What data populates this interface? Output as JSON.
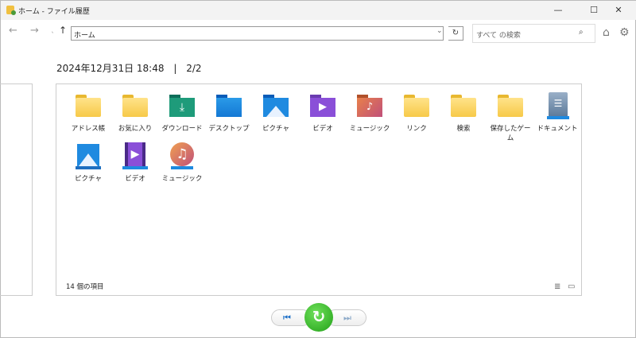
{
  "window": {
    "title": "ホーム - ファイル履歴",
    "minimize": "—",
    "maximize": "☐",
    "close": "✕"
  },
  "toolbar": {
    "back": "←",
    "forward": "→",
    "recent": "ˎ",
    "up": "↑",
    "address": "ホーム",
    "dropdown": "⌄",
    "refresh": "↻",
    "search_placeholder": "すべて の検索",
    "search_icon": "⌕",
    "home": "⌂",
    "settings": "⚙"
  },
  "header": {
    "date": "2024年12月31日 18:48",
    "separator": "|",
    "page": "2/2"
  },
  "items": [
    {
      "label": "アドレス帳",
      "icon": "folder"
    },
    {
      "label": "お気に入り",
      "icon": "folder"
    },
    {
      "label": "ダウンロード",
      "icon": "downloads"
    },
    {
      "label": "デスクトップ",
      "icon": "desktop"
    },
    {
      "label": "ピクチャ",
      "icon": "pictures-folder"
    },
    {
      "label": "ビデオ",
      "icon": "videos-folder"
    },
    {
      "label": "ミュージック",
      "icon": "music-folder"
    },
    {
      "label": "リンク",
      "icon": "folder"
    },
    {
      "label": "検索",
      "icon": "folder"
    },
    {
      "label": "保存したゲーム",
      "icon": "folder"
    },
    {
      "label": "ドキュメント",
      "icon": "documents"
    },
    {
      "label": "ピクチャ",
      "icon": "pictures"
    },
    {
      "label": "ビデオ",
      "icon": "videos"
    },
    {
      "label": "ミュージック",
      "icon": "music"
    }
  ],
  "status": {
    "count": "14 個の項目"
  },
  "playback": {
    "prev": "⏮",
    "restore": "↻",
    "next": "⏭"
  }
}
